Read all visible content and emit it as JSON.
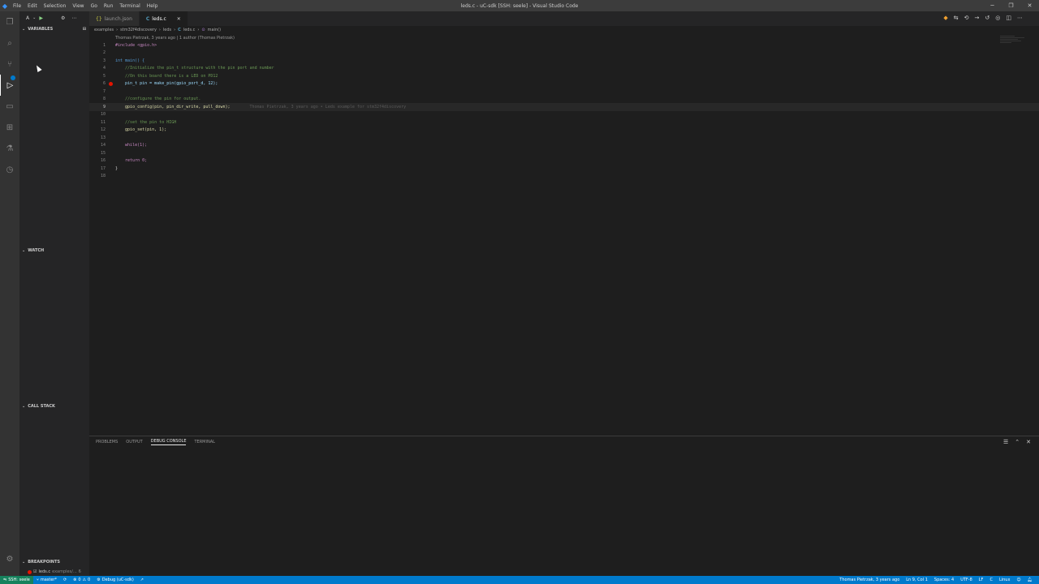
{
  "titlebar": {
    "menu": [
      "File",
      "Edit",
      "Selection",
      "View",
      "Go",
      "Run",
      "Terminal",
      "Help"
    ],
    "title": "leds.c - uC-sdk [SSH: seele] - Visual Studio Code"
  },
  "sidebar": {
    "config_label": "A",
    "sections": {
      "variables": "VARIABLES",
      "watch": "WATCH",
      "call_stack": "CALL STACK",
      "breakpoints": "BREAKPOINTS"
    },
    "breakpoint_item": {
      "file": "leds.c",
      "path": "examples/...",
      "line": "6"
    }
  },
  "tabs": [
    {
      "label": "launch.json",
      "active": false
    },
    {
      "label": "leds.c",
      "active": true
    }
  ],
  "breadcrumb": [
    "examples",
    "stm32f4discovery",
    "leds",
    "leds.c",
    "main()"
  ],
  "codelens": "Thomas Pietrzak, 3 years ago | 1 author (Thomas Pietrzak)",
  "code_lines": [
    {
      "n": "1",
      "text": "#include <gpio.h>"
    },
    {
      "n": "2",
      "text": ""
    },
    {
      "n": "3",
      "text": "int main() {"
    },
    {
      "n": "4",
      "text": "    //Initialize the pin_t structure with the pin port and number"
    },
    {
      "n": "5",
      "text": "    //On this board there is a LED on PD12"
    },
    {
      "n": "6",
      "text": "    pin_t pin = make_pin(gpio_port_d, 12);"
    },
    {
      "n": "7",
      "text": ""
    },
    {
      "n": "8",
      "text": "    //configure the pin for output."
    },
    {
      "n": "9",
      "text": "    gpio_config(pin, pin_dir_write, pull_down);"
    },
    {
      "n": "10",
      "text": ""
    },
    {
      "n": "11",
      "text": "    //set the pin to HIGH"
    },
    {
      "n": "12",
      "text": "    gpio_set(pin, 1);"
    },
    {
      "n": "13",
      "text": ""
    },
    {
      "n": "14",
      "text": "    while(1);"
    },
    {
      "n": "15",
      "text": ""
    },
    {
      "n": "16",
      "text": "    return 0;"
    },
    {
      "n": "17",
      "text": "}"
    },
    {
      "n": "18",
      "text": ""
    }
  ],
  "blame_inline": "Thomas Pietrzak, 3 years ago • Leds example for stm32f4discovery",
  "panel": {
    "tabs": [
      "PROBLEMS",
      "OUTPUT",
      "DEBUG CONSOLE",
      "TERMINAL"
    ],
    "active_tab": "DEBUG CONSOLE"
  },
  "statusbar": {
    "remote": "SSH: seele",
    "branch": "master*",
    "errors": "0",
    "warnings": "0",
    "debug": "Debug (uC-sdk)",
    "blame": "Thomas Pietrzak, 3 years ago",
    "position": "Ln 9, Col 1",
    "spaces": "Spaces: 4",
    "encoding": "UTF-8",
    "eol": "LF",
    "language": "C",
    "platform": "Linux"
  },
  "colors": {
    "accent": "#007acc",
    "remote": "#16825d",
    "breakpoint": "#e51400"
  }
}
